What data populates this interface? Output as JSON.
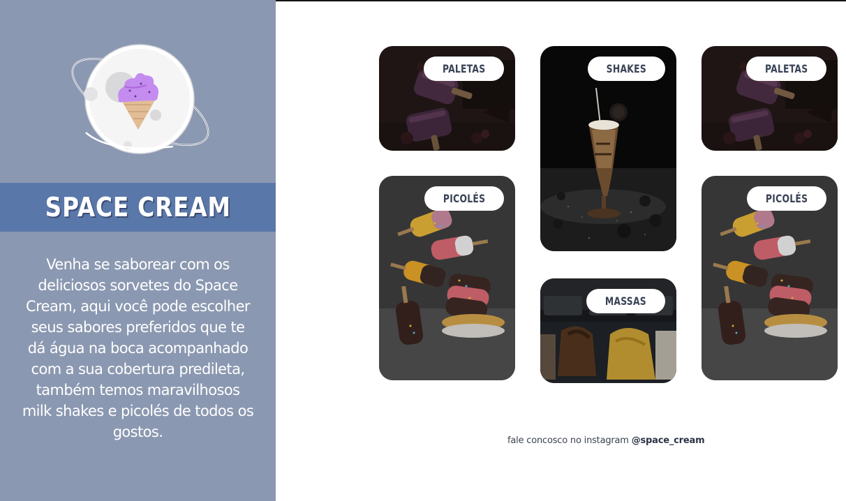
{
  "brand": {
    "title": "SPACE CREAM",
    "description": "Venha se saborear com os deliciosos sorvetes do Space Cream, aqui você pode escolher seus sabores preferidos que te dá água na boca acompanhado com a sua cobertura predileta, também temos maravilhosos milk shakes e picolés de todos os gostos."
  },
  "logo": {
    "icon": "ice-cream-planet-icon"
  },
  "cards": [
    {
      "label": "PALETAS",
      "image": "paletas-photo"
    },
    {
      "label": "SHAKES",
      "image": "milkshake-photo"
    },
    {
      "label": "PALETAS",
      "image": "paletas-photo"
    },
    {
      "label": "PICOLÉS",
      "image": "picoles-photo"
    },
    {
      "label": "MASSAS",
      "image": "massas-photo"
    },
    {
      "label": "PICOLÉS",
      "image": "picoles-photo"
    }
  ],
  "footer": {
    "text": "fale concosco no instagram ",
    "handle": "@space_cream"
  },
  "colors": {
    "sidebar": "#8b98b1",
    "brand_band": "#5a77aa",
    "tag_bg": "#ffffff",
    "tag_text": "#3a4356",
    "ice_cream": "#c58cf0"
  }
}
